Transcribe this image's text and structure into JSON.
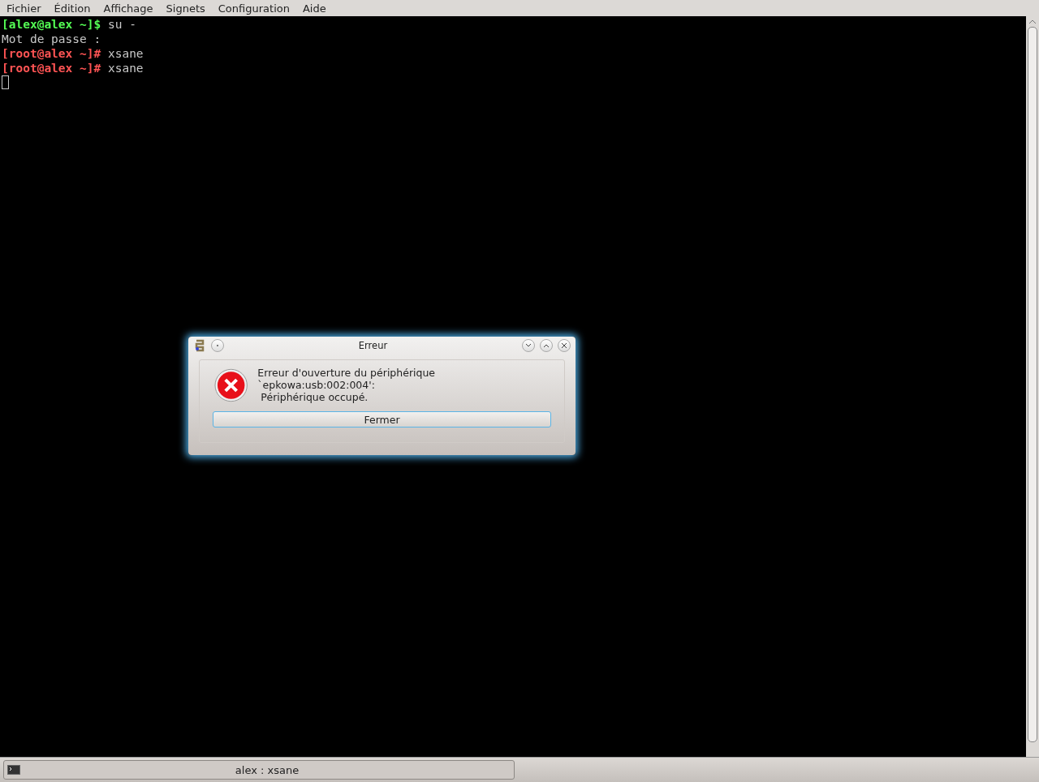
{
  "menu": [
    "Fichier",
    "Édition",
    "Affichage",
    "Signets",
    "Configuration",
    "Aide"
  ],
  "terminal": {
    "lines": [
      [
        {
          "kind": "user_prompt",
          "text": "[alex@alex ~]$"
        },
        {
          "kind": "plain",
          "text": " su -"
        }
      ],
      [
        {
          "kind": "plain",
          "text": "Mot de passe :"
        }
      ],
      [
        {
          "kind": "root_prompt",
          "text": "[root@alex ~]#"
        },
        {
          "kind": "plain",
          "text": " xsane"
        }
      ],
      [
        {
          "kind": "root_prompt",
          "text": "[root@alex ~]#"
        },
        {
          "kind": "plain",
          "text": " xsane"
        }
      ]
    ]
  },
  "dialog": {
    "title": "Erreur",
    "message": "Erreur d'ouverture du périphérique `epkowa:usb:002:004':",
    "detail": "Périphérique occupé.",
    "button": "Fermer"
  },
  "taskbar": {
    "tasks": [
      {
        "label": "alex : xsane",
        "selected": true
      }
    ]
  }
}
